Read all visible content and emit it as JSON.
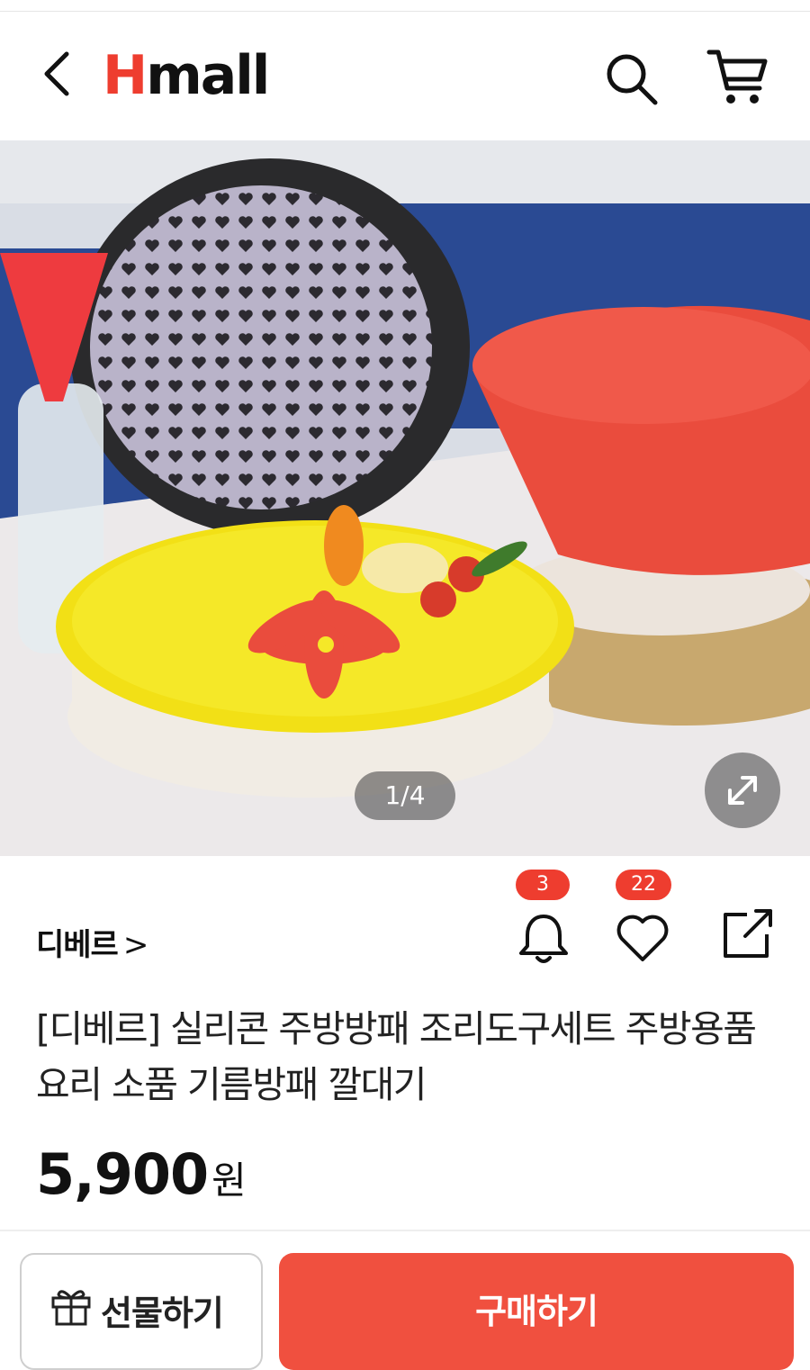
{
  "header": {
    "logo_h": "H",
    "logo_rest": "mall"
  },
  "gallery": {
    "counter": "1/4"
  },
  "product": {
    "brand": "디베르",
    "brand_chevron": ">",
    "title": "[디베르] 실리콘 주방방패 조리도구세트 주방용품 요리 소품 기름방패 깔대기",
    "price": "5,900",
    "price_unit": "원"
  },
  "actions": {
    "alarm_count": "3",
    "like_count": "22"
  },
  "bottom_bar": {
    "gift_label": "선물하기",
    "buy_label": "구매하기"
  },
  "colors": {
    "brand_red": "#ee3d2f",
    "buy_button": "#f0503f"
  }
}
